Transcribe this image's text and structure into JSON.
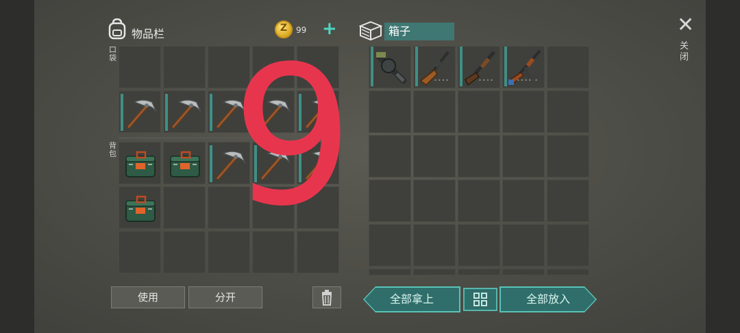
{
  "inventory": {
    "title": "物品栏",
    "coins": "99",
    "pocket_label": "口袋",
    "backpack_label": "背包"
  },
  "container": {
    "title": "箱子"
  },
  "close": {
    "label": "关闭"
  },
  "buttons": {
    "use": "使用",
    "split": "分开",
    "take_all": "全部拿上",
    "put_all": "全部放入"
  },
  "overlay": {
    "text": "9"
  },
  "colors": {
    "accent_teal": "#2f6e6a",
    "overlay_red": "#e8354e",
    "coin_gold": "#d9a51c"
  },
  "pocket_items": [
    "",
    "",
    "",
    "",
    "",
    "pickaxe",
    "pickaxe",
    "pickaxe",
    "pickaxe",
    "pickaxe"
  ],
  "backpack_items": [
    "toolbox",
    "toolbox",
    "pickaxe",
    "pickaxe",
    "pickaxe",
    "toolbox",
    "",
    "",
    "",
    "",
    "",
    "",
    "",
    "",
    ""
  ],
  "box_items": [
    "grenade-launcher",
    "rifle",
    "shotgun",
    "assault-rifle",
    "",
    "",
    "",
    "",
    "",
    "",
    "",
    "",
    "",
    "",
    "",
    "",
    "",
    "",
    "",
    "",
    "",
    "",
    "",
    "",
    "",
    "",
    "",
    "",
    "",
    "",
    ""
  ]
}
